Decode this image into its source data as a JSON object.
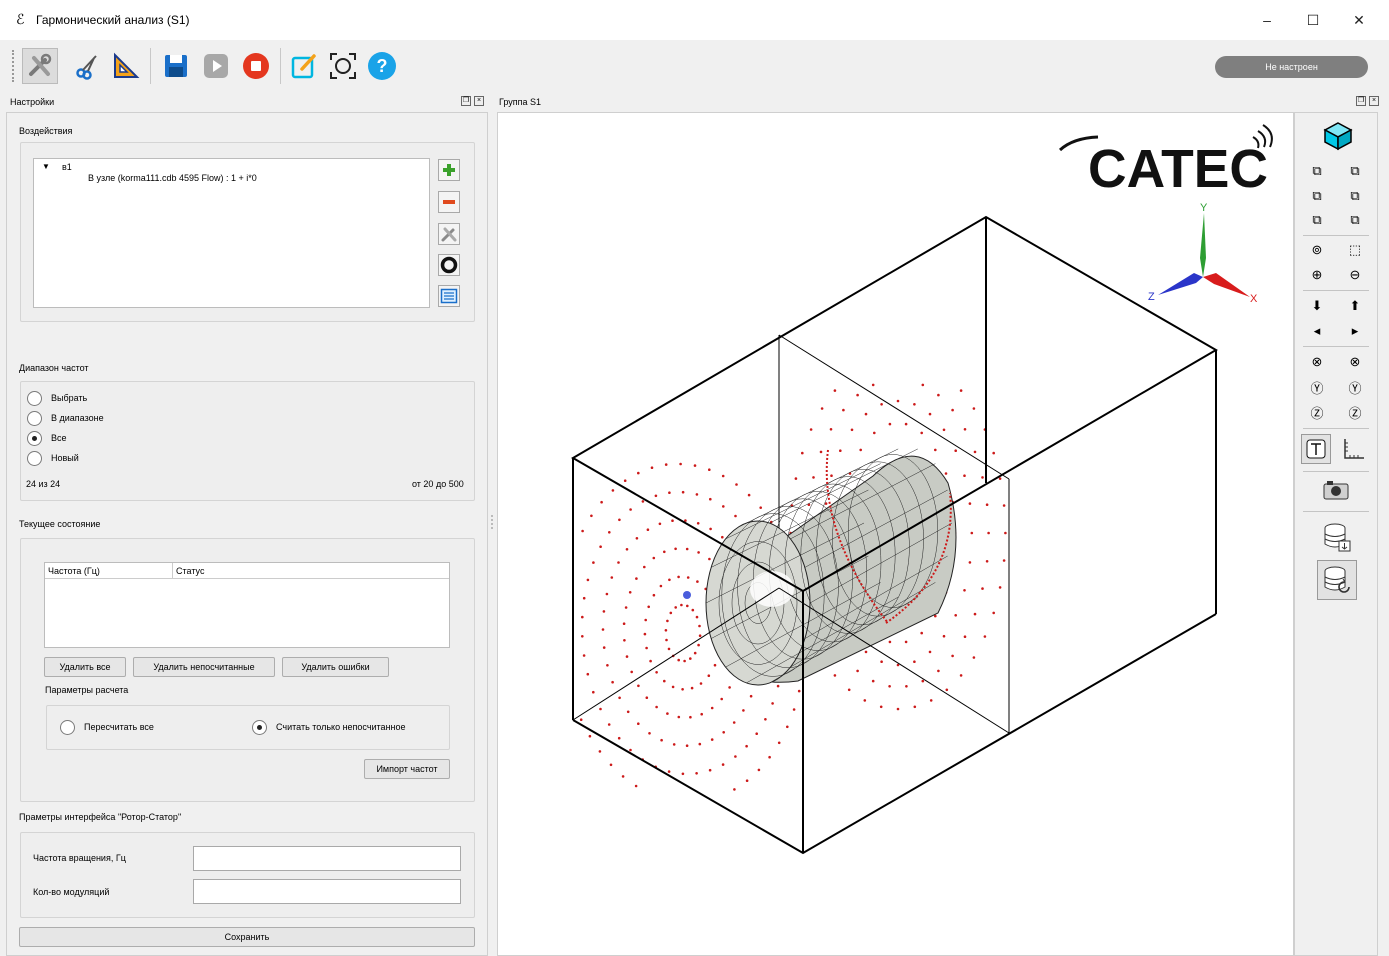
{
  "window": {
    "title": "Гармонический анализ (S1)",
    "controls": [
      "–",
      "☐",
      "✕"
    ]
  },
  "toolbar": {
    "status": "Не настроен",
    "icons": [
      "tools-icon",
      "scissors-icon",
      "ruler-triangle-icon",
      "save-icon",
      "play-icon",
      "stop-icon",
      "edit-icon",
      "target-icon",
      "help-icon"
    ]
  },
  "left_dock": {
    "title": "Настройки",
    "effects": {
      "label": "Воздействия",
      "root": "в1",
      "child": "В узле (korma111.cdb 4595 Flow) : 1 + i*0"
    },
    "freq_range": {
      "label": "Диапазон частот",
      "options": [
        "Выбрать",
        "В диапазоне",
        "Все",
        "Новый"
      ],
      "selected": "Все",
      "count_text": "24 из 24",
      "range_text": "от 20 до 500"
    },
    "current_state": {
      "label": "Текущее состояние",
      "columns": [
        "Частота (Гц)",
        "Статус"
      ],
      "btn_delete_all": "Удалить все",
      "btn_delete_uncalc": "Удалить непосчитанные",
      "btn_delete_errors": "Удалить ошибки",
      "calc_params_label": "Параметры расчета",
      "opt_recalc_all": "Пересчитать все",
      "opt_only_uncalc": "Считать только непосчитанное",
      "btn_import": "Импорт частот"
    },
    "rotor_stator": {
      "label": "Праметры интерфейса \"Ротор-Статор\"",
      "rotation_label": "Частота вращения, Гц",
      "rotation_value": "",
      "modulations_label": "Кол-во модуляций",
      "modulations_value": ""
    },
    "save_button": "Сохранить"
  },
  "viewport": {
    "title": "Группа S1",
    "logo": "CATEC",
    "axes": {
      "x": "X",
      "y": "Y",
      "z": "Z"
    }
  },
  "colors": {
    "accent_cyan": "#00c8e6",
    "mesh_red": "#cc1a1a",
    "status_gray": "#7f7f7f"
  }
}
